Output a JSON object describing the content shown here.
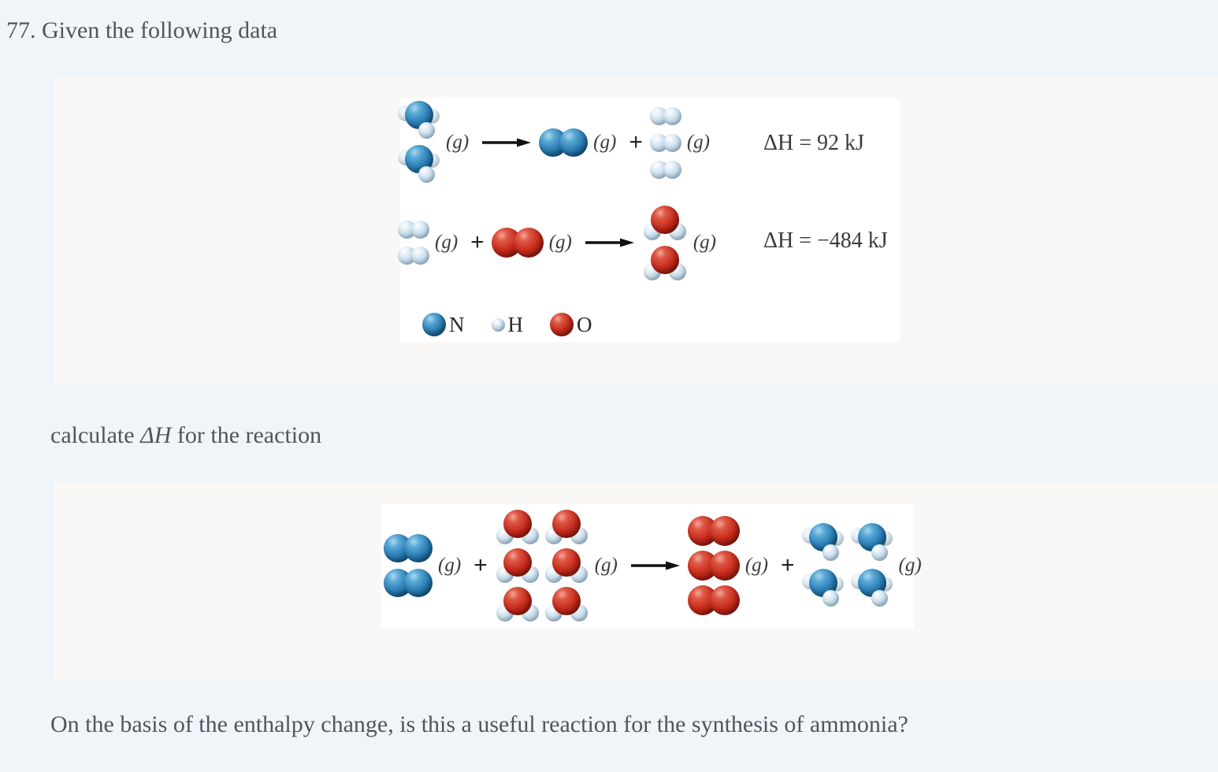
{
  "problem": {
    "number": "77.",
    "intro_text": "77. Given the following data",
    "calculate_text_pre": "calculate ",
    "calculate_delta": "ΔH",
    "calculate_text_post": " for the reaction",
    "closing_question": "On the basis of the enthalpy change, is this a useful reaction for the synthesis of ammonia?"
  },
  "legend": {
    "items": [
      {
        "symbol": "N",
        "color": "#2a7db4",
        "size": "large"
      },
      {
        "symbol": "H",
        "color": "#c2d8e8",
        "size": "small"
      },
      {
        "symbol": "O",
        "color": "#c62a1b",
        "size": "large"
      }
    ]
  },
  "state_label": "(g)",
  "plus": "+",
  "given_reactions": [
    {
      "id": "reaction-1",
      "equation_text": "2 NH3(g) → N2(g) + 3 H2(g)",
      "reactants": [
        {
          "species": "NH3",
          "count": 2,
          "rows": 2,
          "cols": 1
        }
      ],
      "products": [
        {
          "species": "N2",
          "count": 1,
          "rows": 1,
          "cols": 1
        },
        {
          "species": "H2",
          "count": 3,
          "rows": 3,
          "cols": 1
        }
      ],
      "delta_h_label": "ΔH = 92 kJ",
      "delta_h_value": 92,
      "delta_h_units": "kJ"
    },
    {
      "id": "reaction-2",
      "equation_text": "2 H2(g) + O2(g) → 2 H2O(g)",
      "reactants": [
        {
          "species": "H2",
          "count": 2,
          "rows": 2,
          "cols": 1
        },
        {
          "species": "O2",
          "count": 1,
          "rows": 1,
          "cols": 1
        }
      ],
      "products": [
        {
          "species": "H2O",
          "count": 2,
          "rows": 2,
          "cols": 1
        }
      ],
      "delta_h_label": "ΔH = −484 kJ",
      "delta_h_value": -484,
      "delta_h_units": "kJ"
    }
  ],
  "target_reaction": {
    "id": "reaction-target",
    "equation_text": "2 N2(g) + 6 H2O(g) → 3 O2(g) + 4 NH3(g)",
    "reactants": [
      {
        "species": "N2",
        "count": 2,
        "rows": 2,
        "cols": 1
      },
      {
        "species": "H2O",
        "count": 6,
        "rows": 3,
        "cols": 2
      }
    ],
    "products": [
      {
        "species": "O2",
        "count": 3,
        "rows": 3,
        "cols": 1
      },
      {
        "species": "NH3",
        "count": 4,
        "rows": 2,
        "cols": 2
      }
    ]
  },
  "colors": {
    "page_background": "#eff5f9",
    "panel_background": "#f9f8f7",
    "figure_background": "#ffffff",
    "text": "#50555a",
    "nitrogen": "#2a7db4",
    "oxygen": "#c62a1b",
    "hydrogen": "#c2d8e8"
  }
}
